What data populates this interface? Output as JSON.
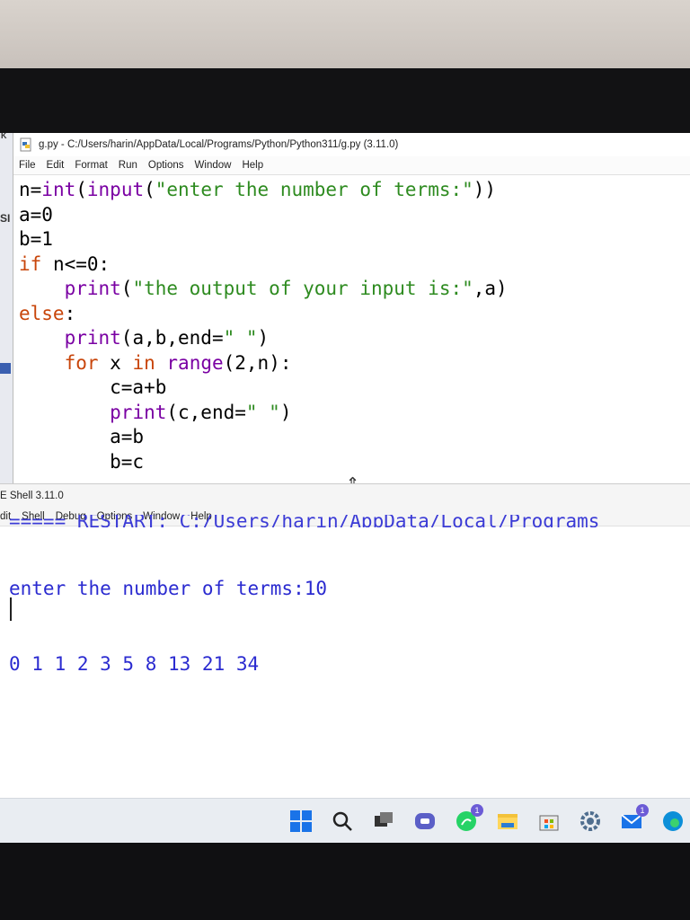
{
  "background_window": {
    "title_fragment": "K",
    "label_fragment": "SI"
  },
  "editor": {
    "title": "g.py - C:/Users/harin/AppData/Local/Programs/Python/Python311/g.py (3.11.0)",
    "menu": [
      "File",
      "Edit",
      "Format",
      "Run",
      "Options",
      "Window",
      "Help"
    ],
    "code_lines": [
      "n=int(input(\"enter the number of terms:\"))",
      "a=0",
      "b=1",
      "if n<=0:",
      "    print(\"the output of your input is:\",a)",
      "else:",
      "    print(a,b,end=\" \")",
      "    for x in range(2,n):",
      "        c=a+b",
      "        print(c,end=\" \")",
      "        a=b",
      "        b=c"
    ]
  },
  "shell": {
    "title": "E Shell 3.11.0",
    "menu": [
      "dit",
      "Shell",
      "Debug",
      "Options",
      "Window",
      "Help"
    ],
    "restart_line": "===== RESTART: C:/Users/harin/AppData/Local/Programs",
    "output_lines": [
      "enter the number of terms:10",
      "0 1 1 2 3 5 8 13 21 34"
    ]
  },
  "taskbar": {
    "icons": [
      "windows-start-icon",
      "search-icon",
      "task-view-icon",
      "chat-icon",
      "whatsapp-icon",
      "file-explorer-icon",
      "store-icon",
      "settings-icon",
      "mail-icon",
      "edge-icon"
    ],
    "badges": {
      "whatsapp": "1",
      "mail": "1"
    }
  },
  "colors": {
    "keyword": "#c8450a",
    "builtin": "#7a00a3",
    "string": "#2e8b20",
    "shell_output": "#2b2bd0"
  }
}
